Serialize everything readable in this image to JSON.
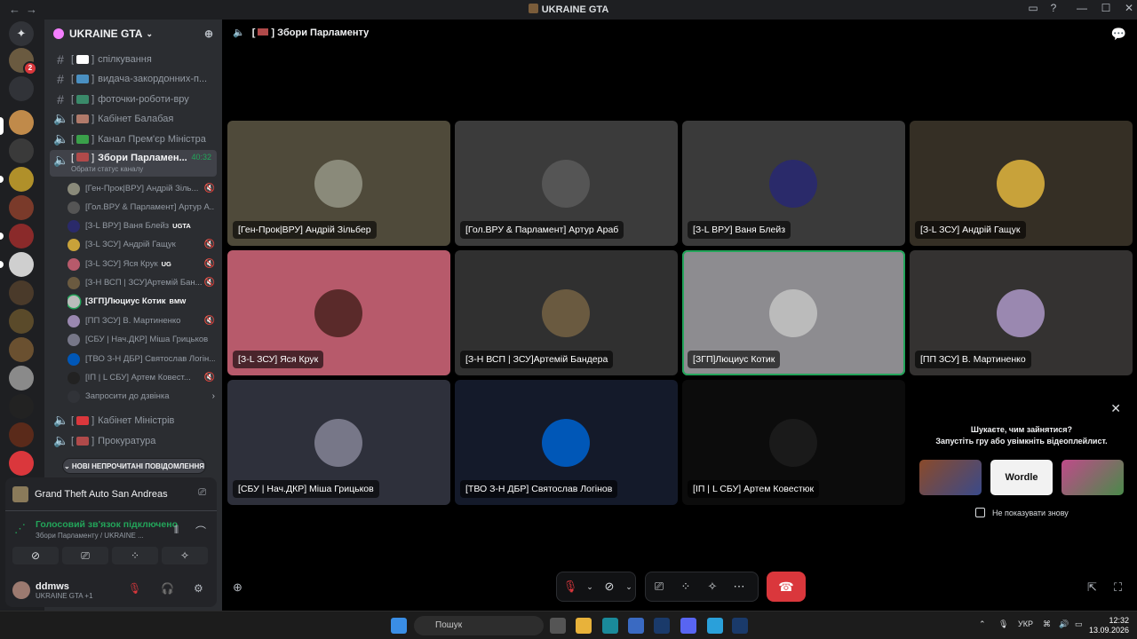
{
  "window": {
    "title": "UKRAINE GTA"
  },
  "guild": {
    "name": "UKRAINE GTA"
  },
  "channels": [
    {
      "label": "спілкування",
      "type": "text"
    },
    {
      "label": "видача-закордонних-п...",
      "type": "text"
    },
    {
      "label": "фоточки-роботи-вру",
      "type": "text"
    },
    {
      "label": "Кабінет Балабая",
      "type": "voice"
    },
    {
      "label": "Канал Прем'єр Міністра",
      "type": "voice"
    },
    {
      "label": "Зборі Парламенту",
      "type": "voice"
    }
  ],
  "active_channel": {
    "name": "Збори Парламен...",
    "timer": "40:32",
    "status": "Обрати статус каналу"
  },
  "voice_users": [
    {
      "name": "[Ген-Прок|ВРУ] Андрій Зіль...",
      "tag": ""
    },
    {
      "name": "[Гол.ВРУ & Парламент] Артур А...",
      "tag": ""
    },
    {
      "name": "[З-L ВРУ] Ваня Блейз",
      "tag": "UGTA"
    },
    {
      "name": "[З-L ЗСУ] Андрій Гащук",
      "tag": ""
    },
    {
      "name": "[З-L ЗСУ] Яся Крук",
      "tag": "UG"
    },
    {
      "name": "[З-Н ВСП | ЗСУ]Артемій Бан...",
      "tag": ""
    },
    {
      "name": "[ЗГП]Люциус Котик",
      "tag": "BMW"
    },
    {
      "name": "[ПП ЗСУ] В. Мартиненко",
      "tag": ""
    },
    {
      "name": "[СБУ | Нач.ДКР] Міша Грицьков",
      "tag": ""
    },
    {
      "name": "[ТВО З-Н ДБР] Святослав Логін...",
      "tag": ""
    },
    {
      "name": "[ІП | L СБУ] Артем Ковест...",
      "tag": ""
    }
  ],
  "invite_label": "Запросити до дзвінка",
  "channels_after": [
    {
      "label": "Кабінет Міністрів"
    },
    {
      "label": "Прокуратура"
    }
  ],
  "new_messages": "НОВІ НЕПРОЧИТАНІ ПОВІДОМЛЕННЯ",
  "activity": {
    "game": "Grand Theft Auto San Andreas"
  },
  "voice_status": {
    "state": "Голосовий зв'язок підключено",
    "channel": "Збори Парламенту / UKRAINE ..."
  },
  "user": {
    "name": "ddmws",
    "status": "UKRAINE GTA +1"
  },
  "stage": {
    "title": "Збори Парламенту"
  },
  "tiles": [
    {
      "label": "[Ген-Прок|ВРУ] Андрій Зільбер",
      "bg": "#4f4a3a",
      "av": "#8a8a7a"
    },
    {
      "label": "[Гол.ВРУ & Парламент] Артур Араб",
      "bg": "#3b3b3b",
      "av": "#555555"
    },
    {
      "label": "[З-L ВРУ] Ваня Блейз",
      "bg": "#3a3a3a",
      "av": "#2a2a6a"
    },
    {
      "label": "[З-L ЗСУ] Андрій Гащук",
      "bg": "#352f25",
      "av": "#c8a23a"
    },
    {
      "label": "[З-L ЗСУ] Яся Крук",
      "bg": "#b75a6b",
      "av": "#5a2a2a"
    },
    {
      "label": "[З-Н ВСП | ЗСУ]Артемій Бандера",
      "bg": "#303030",
      "av": "#6a5a40"
    },
    {
      "label": "[ЗГП]Люциус Котик",
      "bg": "#8d8c90",
      "av": "#bbbbbb"
    },
    {
      "label": "[ПП ЗСУ] В. Мартиненко",
      "bg": "#343231",
      "av": "#9a88b0"
    },
    {
      "label": "[СБУ | Нач.ДКР] Міша Грицьков",
      "bg": "#2e303b",
      "av": "#777788"
    },
    {
      "label": "[ТВО З-Н ДБР] Святослав Логінов",
      "bg": "#141a2a",
      "av": "#0057b7"
    },
    {
      "label": "[ІП | L СБУ] Артем Ковестюк",
      "bg": "#0c0c0c",
      "av": "#1a1a1a"
    }
  ],
  "suggest": {
    "question": "Шукаєте, чим зайнятися?",
    "prompt": "Запустіть гру або увімкніть відеоплейлист.",
    "games": [
      "",
      "Wordle",
      ""
    ],
    "dont_show": "Не показувати знову"
  },
  "taskbar": {
    "search": "Пошук",
    "lang": "УКР",
    "time": "12:32",
    "date": "13.09.2026"
  }
}
